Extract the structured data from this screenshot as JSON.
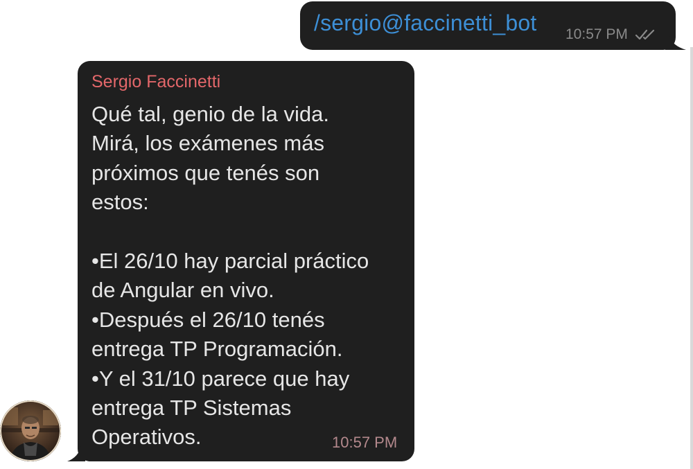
{
  "outgoing_message": {
    "text": "/sergio@faccinetti_bot",
    "time": "10:57 PM",
    "status_icon": "double-check-icon"
  },
  "incoming_message": {
    "sender": "Sergio Faccinetti",
    "text": "Qué tal, genio de la vida.\nMirá, los exámenes más\npróximos que tenés son\nestos:\n\n•El 26/10 hay parcial práctico\nde Angular en vivo.\n•Después el 26/10 tenés\nentrega TP Programación.\n•Y el 31/10 parece que hay\nentrega TP Sistemas\nOperativos.",
    "time": "10:57 PM"
  },
  "colors": {
    "bubble_bg": "#1f1f1f",
    "link_blue": "#3d8fd6",
    "sender_name": "#e3676a",
    "message_text": "#e6e6e6",
    "time_text": "#8a8a8a"
  }
}
